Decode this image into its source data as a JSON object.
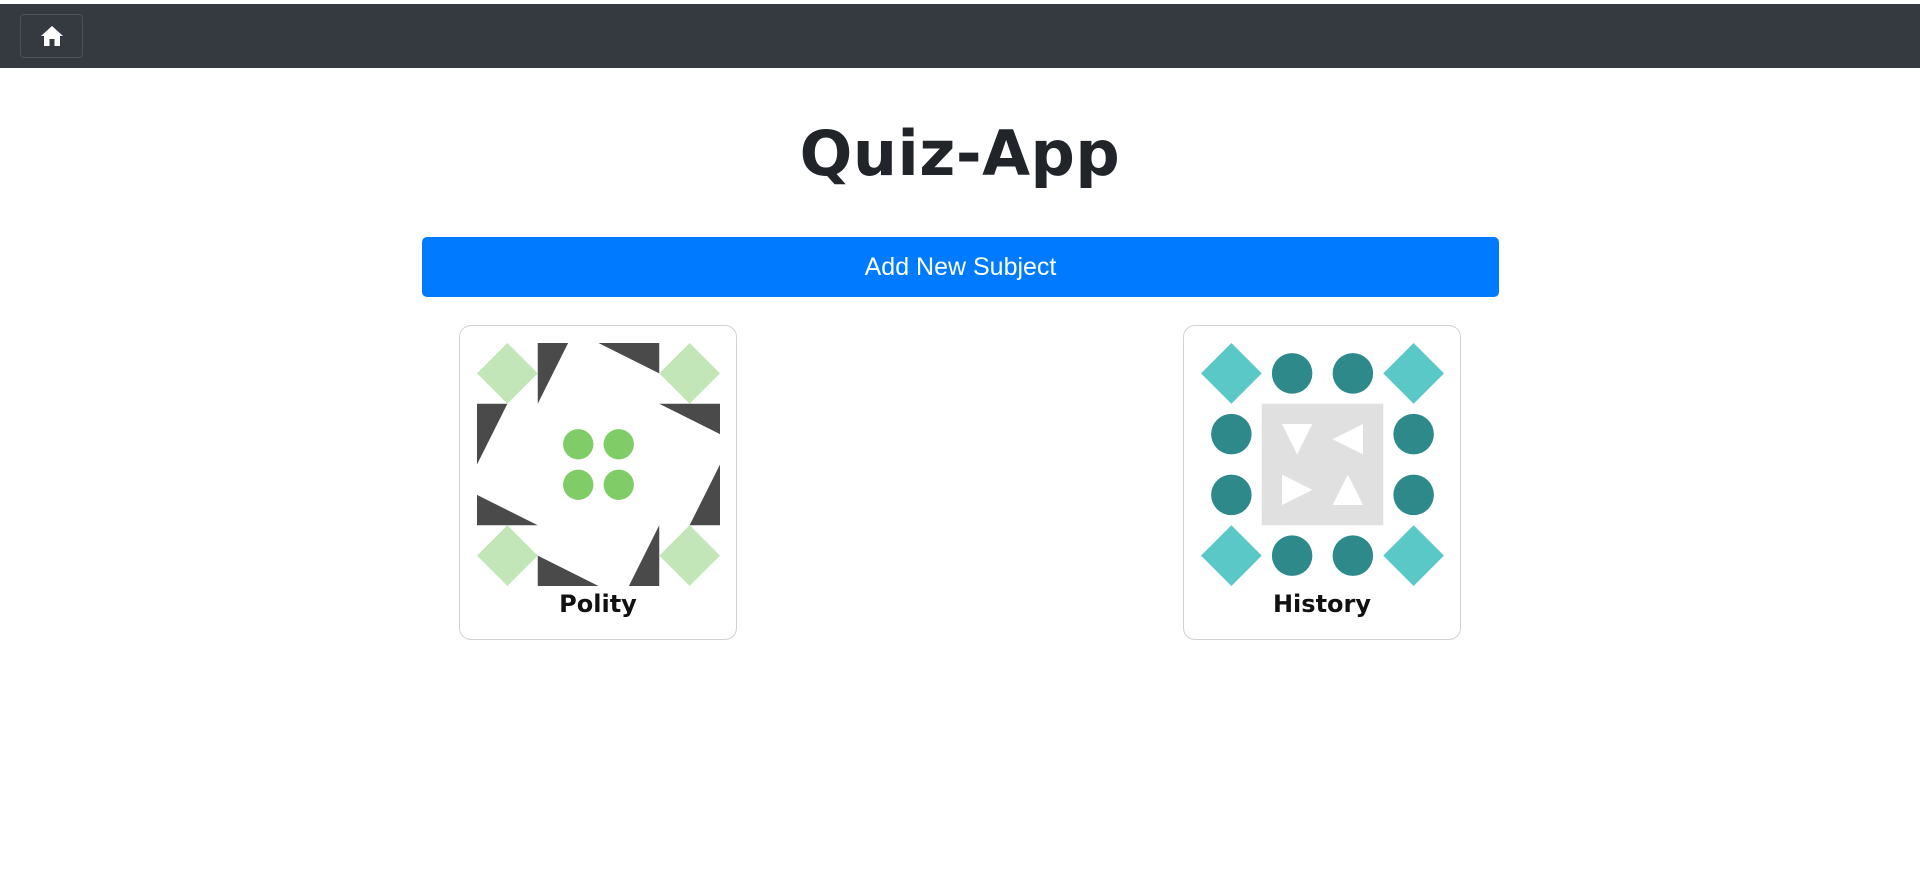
{
  "navbar": {
    "home_icon": "home-icon"
  },
  "page": {
    "title": "Quiz-App"
  },
  "actions": {
    "add_subject_label": "Add New Subject"
  },
  "subjects": [
    {
      "name": "Polity",
      "art": "polity-pattern"
    },
    {
      "name": "History",
      "art": "history-pattern"
    }
  ],
  "colors": {
    "navbar_bg": "#343a40",
    "primary": "#007bff",
    "polity_light_green": "#c3e6b8",
    "polity_green": "#80cd68",
    "polity_dark": "#4a4a4a",
    "history_teal_light": "#5bc8c8",
    "history_teal_dark": "#2e8a8a",
    "history_center_bg": "#e0e0e0"
  }
}
